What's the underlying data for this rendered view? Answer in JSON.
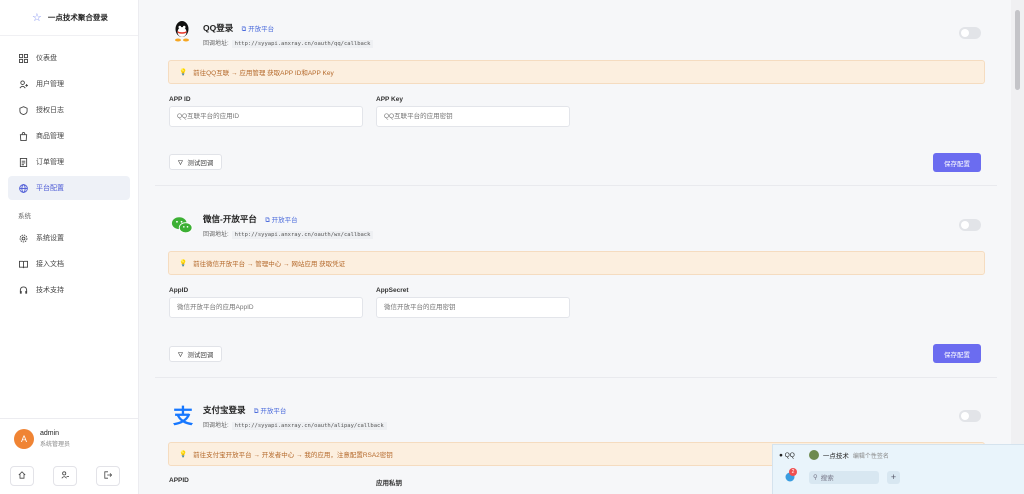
{
  "sidebar": {
    "brand_title": "一点技术聚合登录",
    "items": [
      {
        "label": "仪表盘",
        "icon": "dashboard-icon"
      },
      {
        "label": "用户管理",
        "icon": "users-icon"
      },
      {
        "label": "授权日志",
        "icon": "log-icon"
      },
      {
        "label": "商品管理",
        "icon": "bag-icon"
      },
      {
        "label": "订单管理",
        "icon": "order-icon"
      },
      {
        "label": "平台配置",
        "icon": "globe-icon",
        "active": true
      }
    ],
    "section_label": "系统",
    "system_items": [
      {
        "label": "系统设置",
        "icon": "gear-icon"
      },
      {
        "label": "接入文档",
        "icon": "book-icon"
      },
      {
        "label": "技术支持",
        "icon": "headset-icon"
      }
    ],
    "user": {
      "name": "admin",
      "role": "系统管理员",
      "avatar_letter": "A"
    }
  },
  "platforms": [
    {
      "title": "QQ登录",
      "open_link": "开放平台",
      "callback_label": "回调地址:",
      "callback_url": "http://syyapi.anxray.cn/oauth/qq/callback",
      "tip": "前往QQ互联 → 应用管理 获取APP ID和APP Key",
      "fields": [
        {
          "label": "APP ID",
          "placeholder": "QQ互联平台的应用ID"
        },
        {
          "label": "APP Key",
          "placeholder": "QQ互联平台的应用密钥"
        }
      ],
      "test_label": "测试回调",
      "save_label": "保存配置"
    },
    {
      "title": "微信-开放平台",
      "open_link": "开放平台",
      "callback_label": "回调地址:",
      "callback_url": "http://syyapi.anxray.cn/oauth/wx/callback",
      "tip": "前往微信开放平台 → 管理中心 → 网站应用 获取凭证",
      "fields": [
        {
          "label": "AppID",
          "placeholder": "微信开放平台的应用AppID"
        },
        {
          "label": "AppSecret",
          "placeholder": "微信开放平台的应用密钥"
        }
      ],
      "test_label": "测试回调",
      "save_label": "保存配置"
    },
    {
      "title": "支付宝登录",
      "open_link": "开放平台",
      "callback_label": "回调地址:",
      "callback_url": "http://syyapi.anxray.cn/oauth/alipay/callback",
      "tip": "前往支付宝开放平台 → 开发者中心 → 我的应用，注意配置RSA2密钥",
      "fields": [
        {
          "label": "APPID",
          "placeholder": ""
        },
        {
          "label": "应用私钥",
          "placeholder": ""
        }
      ]
    }
  ],
  "qq_widget": {
    "app_name": "QQ",
    "contact_name": "一点技术",
    "signature": "编辑个性签名",
    "badge_count": "2",
    "search_placeholder": "搜索"
  },
  "colors": {
    "accent": "#6b6cf0",
    "tip_bg": "#fcefdf",
    "tip_text": "#b4682a",
    "active_nav": "#4d5bd6"
  }
}
